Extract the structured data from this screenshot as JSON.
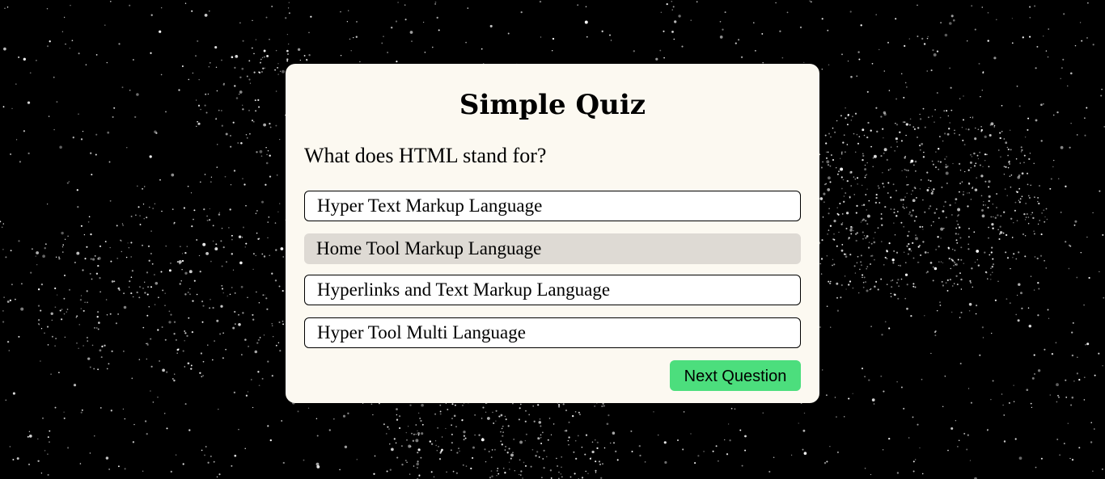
{
  "quiz": {
    "title": "Simple Quiz",
    "question": "What does HTML stand for?",
    "options": [
      {
        "label": "Hyper Text Markup Language"
      },
      {
        "label": "Home Tool Markup Language"
      },
      {
        "label": "Hyperlinks and Text Markup Language"
      },
      {
        "label": "Hyper Tool Multi Language"
      }
    ],
    "next_button_label": "Next Question"
  },
  "colors": {
    "background": "#000000",
    "card": "#fcf9f1",
    "option_hover": "#dedad4",
    "next_button": "#4cde7d"
  }
}
